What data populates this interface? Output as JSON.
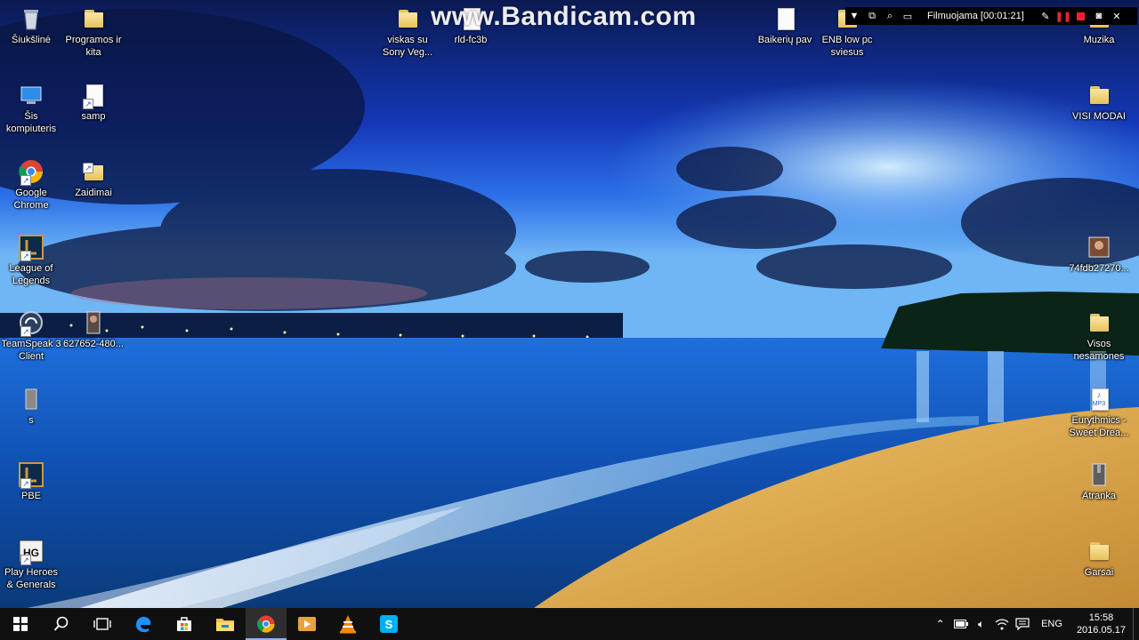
{
  "overlay": {
    "watermark": "www.Bandicam.com",
    "status": "Filmuojama [00:01:21]"
  },
  "desktop": {
    "left_column": [
      {
        "label": "Šiukšlinė",
        "icon": "recycle-bin-icon"
      },
      {
        "label": "Šis\nkompiuteris",
        "icon": "computer-icon"
      },
      {
        "label": "Google\nChrome",
        "icon": "chrome-icon"
      },
      {
        "label": "League of\nLegends",
        "icon": "league-of-legends-icon"
      },
      {
        "label": "TeamSpeak 3\nClient",
        "icon": "teamspeak-icon"
      },
      {
        "label": "s",
        "icon": "file-icon"
      },
      {
        "label": "PBE",
        "icon": "pbe-icon"
      },
      {
        "label": "Play Heroes\n& Generals",
        "icon": "heroes-generals-icon"
      }
    ],
    "second_column": [
      {
        "label": "Programos ir\nkita",
        "icon": "folder-icon"
      },
      {
        "label": "samp",
        "icon": "document-icon"
      },
      {
        "label": "Zaidimai",
        "icon": "folder-icon"
      },
      {
        "label": "627652-480...",
        "icon": "image-icon"
      }
    ],
    "top_row": [
      {
        "label": "viskas su\nSony Veg...",
        "icon": "folder-icon"
      },
      {
        "label": "rld-fc3b",
        "icon": "document-icon"
      },
      {
        "label": "Baikerių pav",
        "icon": "document-icon"
      },
      {
        "label": "ENB low pc\nsviesus",
        "icon": "folder-icon"
      }
    ],
    "right_column": [
      {
        "label": "Muzika",
        "icon": "folder-icon"
      },
      {
        "label": "VISI MODAI",
        "icon": "folder-icon"
      },
      {
        "label": "74fdb27270...",
        "icon": "image-icon"
      },
      {
        "label": "Visos\nnesamones",
        "icon": "folder-icon"
      },
      {
        "label": "Eurythmics -\nSweet Drea...",
        "icon": "mp3-icon"
      },
      {
        "label": "Atranka",
        "icon": "archive-icon"
      },
      {
        "label": "Garsai",
        "icon": "folder-icon"
      }
    ]
  },
  "taskbar": {
    "apps": [
      "start-icon",
      "search-icon",
      "task-view-icon",
      "edge-icon",
      "store-icon",
      "file-explorer-icon",
      "chrome-icon",
      "media-player-icon",
      "vlc-icon",
      "skype-icon"
    ],
    "active_app": "chrome-icon",
    "tray": {
      "language": "ENG",
      "time": "15:58",
      "date": "2016.05.17"
    }
  },
  "colors": {
    "taskbar": "#101010",
    "accent": "#8ab4f8",
    "sky_top": "#0a1b6e",
    "sand": "#d9a44a"
  }
}
